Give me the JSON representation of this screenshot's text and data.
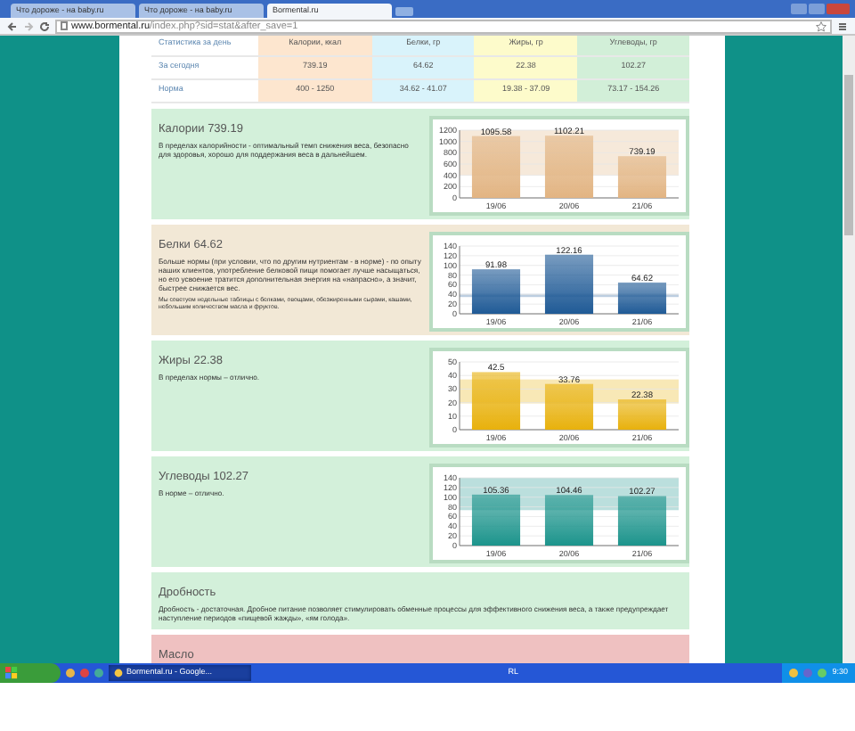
{
  "browser": {
    "tabs": [
      {
        "title": "Что дороже - на baby.ru",
        "selected": false
      },
      {
        "title": "Что дороже - на baby.ru",
        "selected": false
      },
      {
        "title": "Bormental.ru",
        "selected": true
      }
    ],
    "address": {
      "host": "www.bormental.ru",
      "path": "/index.php?sid=stat&after_save=1"
    }
  },
  "stats_table": {
    "columns": [
      {
        "label": "Статистика за день",
        "color": "#ffffff"
      },
      {
        "label": "Калории, ккал",
        "color": "#fde6cf"
      },
      {
        "label": "Белки, гр",
        "color": "#d9f3fb"
      },
      {
        "label": "Жиры, гр",
        "color": "#fdfbcb"
      },
      {
        "label": "Углеводы, гр",
        "color": "#d2efd8"
      }
    ],
    "rows": [
      {
        "cells": [
          "За сегодня",
          "739.19",
          "64.62",
          "22.38",
          "102.27"
        ]
      },
      {
        "cells": [
          "Норма",
          "400 - 1250",
          "34.62 - 41.07",
          "19.38 - 37.09",
          "73.17 - 154.26"
        ]
      }
    ]
  },
  "sections": [
    {
      "title": "Калории 739.19",
      "color": "#d3f0da",
      "text": "В пределах калорийности - оптимальный темп снижения веса, безопасно для здоровья, хорошо для поддержания веса в дальнейшем.",
      "chart_data": {
        "type": "bar",
        "categories": [
          "19/06",
          "20/06",
          "21/06"
        ],
        "series": [
          {
            "color": "#e2b482",
            "values": [
              1095.58,
              1102.21,
              739.19
            ]
          }
        ],
        "ylim": [
          0,
          1200
        ],
        "yticks": [
          0,
          200,
          400,
          600,
          800,
          1000,
          1200
        ],
        "grid": true,
        "data_labels": true,
        "bands": [
          {
            "axis": "y",
            "from": 400,
            "to": 1200
          }
        ]
      }
    },
    {
      "title": "Белки 64.62",
      "color": "#f2e8d6",
      "text": "Больше нормы (при условии, что по другим нутриентам - в норме) - по опыту наших клиентов, употребление белковой пищи помогает лучше насыщаться, но его усвоение тратится дополнительная энергия на «напрасно», а значит, быстрее снижается вес.",
      "note": "Мы советуем недельные таблицы с белками, овощами, обезжиренными сырами, кашами, небольшим количеством масла и фруктов.",
      "chart_data": {
        "type": "bar",
        "categories": [
          "19/06",
          "20/06",
          "21/06"
        ],
        "series": [
          {
            "color": "#1f5a96",
            "values": [
              91.98,
              122.16,
              64.62
            ]
          }
        ],
        "ylim": [
          0,
          140
        ],
        "yticks": [
          0,
          20,
          40,
          60,
          80,
          100,
          120,
          140
        ],
        "grid": true,
        "data_labels": true,
        "bands": [
          {
            "axis": "y",
            "from": 34.62,
            "to": 41.07
          }
        ]
      }
    },
    {
      "title": "Жиры 22.38",
      "color": "#d3f0da",
      "text": "В пределах нормы – отлично.",
      "chart_data": {
        "type": "bar",
        "categories": [
          "19/06",
          "20/06",
          "21/06"
        ],
        "series": [
          {
            "color": "#e8b10c",
            "values": [
              42.5,
              33.76,
              22.38
            ]
          }
        ],
        "ylim": [
          0,
          50
        ],
        "yticks": [
          0,
          10,
          20,
          30,
          40,
          50
        ],
        "grid": true,
        "data_labels": true,
        "bands": [
          {
            "axis": "y",
            "from": 19.38,
            "to": 37.09
          }
        ]
      }
    },
    {
      "title": "Углеводы 102.27",
      "color": "#d3f0da",
      "text": "В норме – отлично.",
      "chart_data": {
        "type": "bar",
        "categories": [
          "19/06",
          "20/06",
          "21/06"
        ],
        "series": [
          {
            "color": "#1c948c",
            "values": [
              105.36,
              104.46,
              102.27
            ]
          }
        ],
        "ylim": [
          0,
          140
        ],
        "yticks": [
          0,
          20,
          40,
          60,
          80,
          100,
          120,
          140
        ],
        "grid": true,
        "data_labels": true,
        "bands": [
          {
            "axis": "y",
            "from": 73.17,
            "to": 140
          }
        ]
      }
    },
    {
      "title": "Дробность",
      "color": "#d3f0da",
      "text": "Дробность - достаточная. Дробное питание позволяет стимулировать обменные процессы для эффективного снижения веса, а также предупреждает наступление периодов «пищевой жажды», «ям голода»."
    },
    {
      "title": "Масло",
      "color": "#efc1c1"
    }
  ],
  "taskbar": {
    "tasks": [
      {
        "title": "Bormental.ru - Google...",
        "selected": true
      }
    ],
    "tray": {
      "language": "RL",
      "time": "9:30"
    }
  }
}
